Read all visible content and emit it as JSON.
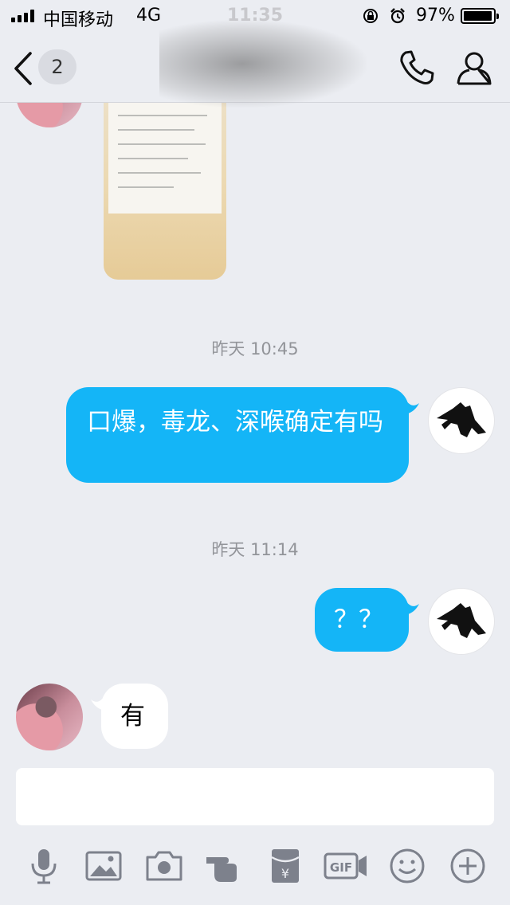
{
  "status_bar": {
    "carrier": "中国移动",
    "network": "4G",
    "time": "11:35",
    "battery_percent": "97%",
    "battery_level": 0.97
  },
  "nav": {
    "unread_count": "2",
    "icons": [
      "back-chevron-icon",
      "phone-icon",
      "person-icon"
    ]
  },
  "messages": [
    {
      "type": "image",
      "sender": "other"
    },
    {
      "type": "time",
      "text": "昨天 10:45"
    },
    {
      "type": "text",
      "sender": "me",
      "text": "口爆，毒龙、深喉确定有吗"
    },
    {
      "type": "time",
      "text": "昨天 11:14"
    },
    {
      "type": "text",
      "sender": "me",
      "text": "？？"
    },
    {
      "type": "text",
      "sender": "other",
      "text": "有"
    }
  ],
  "composer": {
    "value": ""
  },
  "toolbar": {
    "icons": [
      "microphone-icon",
      "image-icon",
      "camera-icon",
      "poke-hand-icon",
      "red-packet-icon",
      "gif-icon",
      "emoji-icon",
      "plus-icon"
    ]
  },
  "colors": {
    "background": "#ebedf2",
    "outgoing_bubble": "#14b5f7",
    "incoming_bubble": "#ffffff",
    "time_label": "#929499",
    "icon_gray": "#7d818c"
  }
}
